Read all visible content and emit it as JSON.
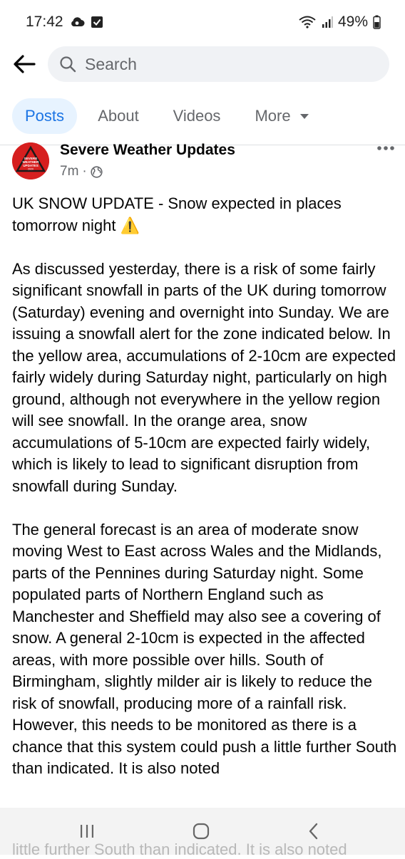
{
  "status_bar": {
    "time": "17:42",
    "battery": "49%"
  },
  "header": {
    "search_placeholder": "Search"
  },
  "tabs": [
    {
      "label": "Posts",
      "active": true
    },
    {
      "label": "About",
      "active": false
    },
    {
      "label": "Videos",
      "active": false
    },
    {
      "label": "More",
      "active": false
    }
  ],
  "post": {
    "author": "Severe Weather Updates",
    "avatar_text": [
      "SEVERE",
      "WEATHER",
      "UPDATES",
      "2020"
    ],
    "time": "7m",
    "paragraphs": [
      "UK SNOW UPDATE  - Snow expected in places tomorrow night ⚠️",
      "As discussed yesterday, there is a risk of some fairly significant snowfall in parts of the UK during tomorrow (Saturday) evening and overnight into Sunday. We are issuing a snowfall alert for the zone indicated below. In the yellow area, accumulations of 2-10cm are expected fairly widely during Saturday night, particularly on high ground, although not everywhere in the yellow region will see snowfall. In the orange area, snow accumulations of 5-10cm are expected fairly widely, which is likely to lead to significant disruption from snowfall during Sunday.",
      "The general forecast is an area of moderate snow moving West to East across Wales and the Midlands, parts of the Pennines during Saturday night. Some populated parts of Northern England such as Manchester and Sheffield may also see a covering of snow. A general 2-10cm is expected in the affected areas, with more possible over hills. South of Birmingham, slightly milder air is likely to reduce the risk of snowfall, producing more of a rainfall risk. However, this needs to be monitored as there is a chance that this system could push a little further South than indicated. It is also noted"
    ]
  },
  "underlay_text": "little further South than indicated. It is also noted",
  "colors": {
    "accent": "#1b74e4",
    "active_tab_bg": "#e7f3ff",
    "search_bg": "#f0f2f5",
    "avatar_red": "#d61f1f"
  },
  "icons": {
    "back": "arrow-left-icon",
    "search": "search-icon",
    "more": "more-horizontal-icon",
    "globe": "globe-icon",
    "caret": "caret-down-icon",
    "nav_recents": "recents-icon",
    "nav_home": "home-icon",
    "nav_back": "back-chevron-icon"
  }
}
